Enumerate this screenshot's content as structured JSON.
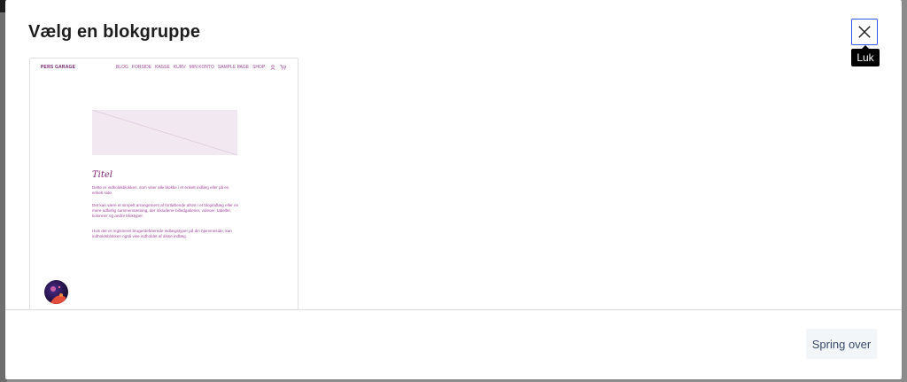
{
  "modal": {
    "title": "Vælg en blokgruppe",
    "close_tooltip": "Luk",
    "skip_label": "Spring over"
  },
  "preview": {
    "site_title": "PERS GARAGE",
    "nav_items": [
      "BLOG",
      "FORSIDE",
      "KASSE",
      "KURV",
      "MIN KONTO",
      "SAMPLE PAGE",
      "SHOP"
    ],
    "nav_icons": [
      "user-icon",
      "cart-icon"
    ],
    "heading": "Titel",
    "paragraphs": [
      "Dette er indholdsblokken, som viser alle blokke i et enkelt indlæg eller på en enkelt side.",
      "Det kan være et simpelt arrangement af fortløbende afsnit i et blogindlæg eller en mere udførlig sammensætning, der inkluderer billedgallerier, videoer, tabeller, kolonner og andre bloktyper.",
      "Hvis der er registreret brugerdefinerede indlægstyper på din hjemmeside, kan indholdsblokken også vise indholdet af disse indlæg."
    ]
  },
  "colors": {
    "accent": "#3858e9",
    "preview_primary": "#7a1f6f",
    "preview_secondary": "#a0499a",
    "preview_image_bg": "#f1e8f1"
  }
}
